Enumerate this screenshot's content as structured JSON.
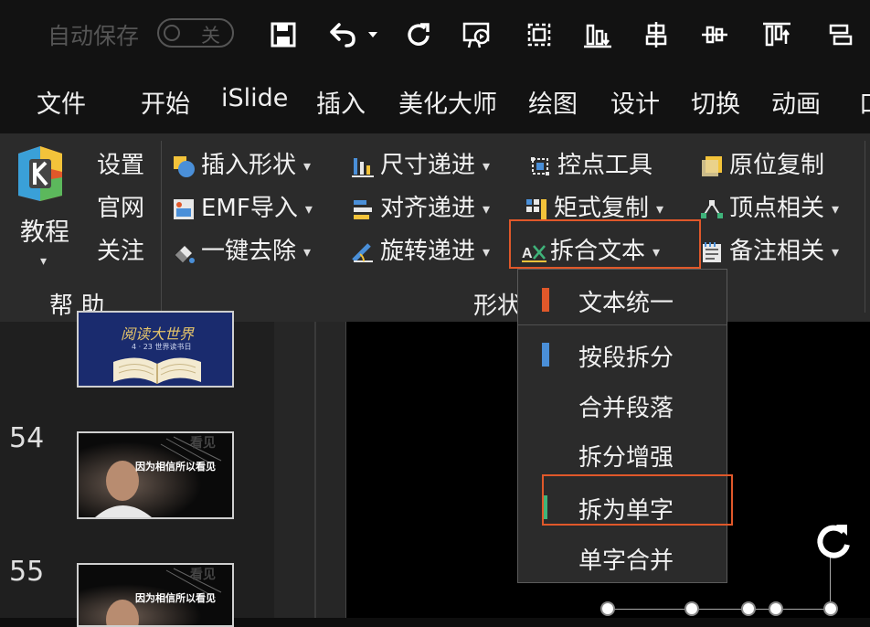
{
  "titlebar": {
    "autosave_label": "自动保存",
    "autosave_state": "关",
    "quick_access_icons": [
      "save-icon",
      "undo-icon",
      "undo-dropdown-icon",
      "redo-icon",
      "present-icon",
      "select-icon",
      "align-bottom-icon",
      "distribute-icon",
      "center-icon",
      "align-top-icon",
      "more-icon"
    ]
  },
  "menu": {
    "items": [
      "文件",
      "开始",
      "iSlide",
      "插入",
      "美化大师",
      "绘图",
      "设计",
      "切换",
      "动画",
      "口"
    ]
  },
  "ribbon": {
    "help_group": {
      "big_button_label": "教程",
      "links": [
        "设置",
        "官网",
        "关注"
      ],
      "group_label": "帮 助"
    },
    "shape_group": {
      "group_label": "形状",
      "col1": [
        "插入形状",
        "EMF导入",
        "一键去除"
      ],
      "col2": [
        "尺寸递进",
        "对齐递进",
        "旋转递进"
      ],
      "col3": [
        "控点工具",
        "矩式复制",
        "拆合文本"
      ],
      "col4": [
        "原位复制",
        "顶点相关",
        "备注相关"
      ]
    }
  },
  "dropdown": {
    "items": [
      {
        "label": "文本统一",
        "marker": "#e0582a"
      },
      {
        "label": "按段拆分",
        "marker": "#4a8fd8"
      },
      {
        "label": "合并段落",
        "marker": ""
      },
      {
        "label": "拆分增强",
        "marker": ""
      },
      {
        "label": "拆为单字",
        "marker": "#3fb37a"
      },
      {
        "label": "单字合并",
        "marker": ""
      }
    ]
  },
  "slides": {
    "numbers": [
      "54",
      "55"
    ],
    "thumb_top_text": "阅读大世界",
    "thumb_top_sub": "4 · 23  世界读书日",
    "thumb_quote_54": "因为相信所以看见",
    "thumb_quote_55": "因为相信所以看见",
    "thumb_word": "看见"
  },
  "colors": {
    "accent": "#e0582a",
    "ribbon_bg": "#2b2b2b",
    "dark_bg": "#121212"
  }
}
